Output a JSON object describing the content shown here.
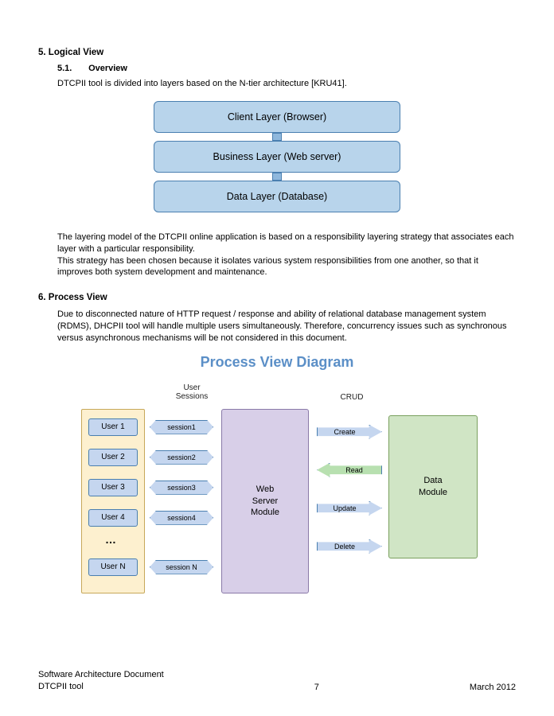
{
  "section5": {
    "num": "5.",
    "title": "Logical View",
    "sub": {
      "num": "5.1.",
      "title": "Overview",
      "intro": "DTCPII tool is divided into layers based on the N-tier architecture [KRU41]."
    },
    "layers": [
      "Client Layer (Browser)",
      "Business Layer (Web server)",
      "Data Layer (Database)"
    ],
    "para1": "The layering model of the DTCPII online application is based on a responsibility layering strategy that associates each layer with a particular responsibility.",
    "para2": "This strategy has been chosen because it isolates various system responsibilities from one another, so that it improves both system development and maintenance."
  },
  "section6": {
    "num": "6.",
    "title": "Process View",
    "para": "Due to disconnected nature of HTTP request / response and ability of relational database management system (RDMS), DHCPII tool will handle multiple users simultaneously. Therefore, concurrency issues such as synchronous versus asynchronous mechanisms will be not considered in this document."
  },
  "process": {
    "title": "Process View Diagram",
    "userSessionsLabel": "User\nSessions",
    "crudLabel": "CRUD",
    "users": [
      "User 1",
      "User 2",
      "User 3",
      "User 4",
      "User N"
    ],
    "dots": "…",
    "sessions": [
      "session1",
      "session2",
      "session3",
      "session4",
      "session N"
    ],
    "webModule": "Web\nServer\nModule",
    "dataModule": "Data\nModule",
    "crud": [
      "Create",
      "Read",
      "Update",
      "Delete"
    ]
  },
  "footer": {
    "docTitle": "Software Architecture Document",
    "tool": "DTCPII tool",
    "page": "7",
    "date": "March 2012"
  }
}
